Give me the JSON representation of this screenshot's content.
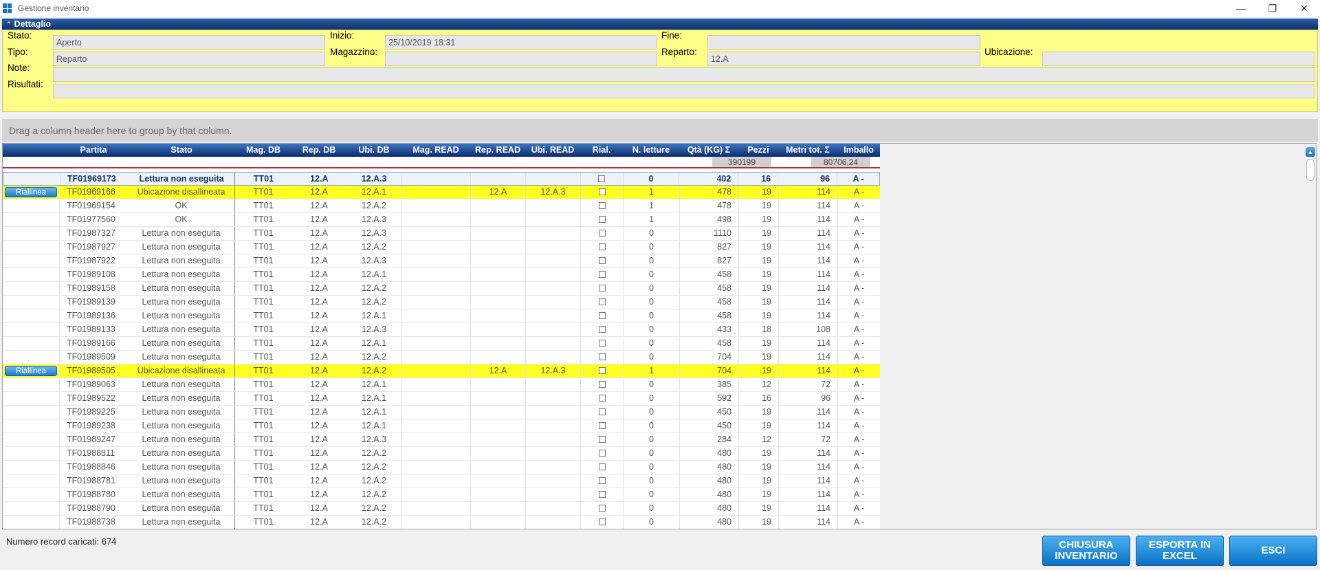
{
  "window": {
    "title": "Gestione inventario",
    "min_glyph": "—",
    "restore_glyph": "❐",
    "close_glyph": "✕"
  },
  "detail": {
    "header": "Dettaglio",
    "chevron": "⌃",
    "stato_label": "Stato:",
    "stato_value": "Aperto",
    "inizio_label": "Inizio:",
    "inizio_value": "25/10/2019 18:31",
    "fine_label": "Fine:",
    "fine_value": "",
    "tipo_label": "Tipo:",
    "tipo_value": "Reparto",
    "magazzino_label": "Magazzino:",
    "magazzino_value": "",
    "reparto_label": "Reparto:",
    "reparto_value": "12.A",
    "ubicazione_label": "Ubicazione:",
    "ubicazione_value": "",
    "note_label": "Note:",
    "note_value": "",
    "risultati_label": "Risultati:",
    "risultati_value": ""
  },
  "groupbar": {
    "text": "Drag a column header here to group by that column."
  },
  "grid": {
    "headers": {
      "btn": "",
      "partita": "Partita",
      "stato": "Stato",
      "mag_db": "Mag. DB",
      "rep_db": "Rep. DB",
      "ubi_db": "Ubi. DB",
      "mag_read": "Mag. READ",
      "rep_read": "Rep. READ",
      "ubi_read": "Ubi. READ",
      "rial": "Rial.",
      "n_letture": "N. letture",
      "qta": "Qtà (KG)  Σ",
      "pezzi": "Pezzi",
      "metri": "Metri tot.  Σ",
      "imballo": "Imballo"
    },
    "summary": {
      "qta": "390199",
      "metri": "80706,24"
    },
    "riallinea_label": "Riallinea",
    "rows": [
      {
        "btn": false,
        "partita": "TF01969173",
        "stato": "Lettura non eseguita",
        "mag": "TT01",
        "rep": "12.A",
        "ubi": "12.A.3",
        "magr": "",
        "repr": "",
        "ubir": "",
        "nlet": "0",
        "qta": "402",
        "pezzi": "16",
        "metri": "96",
        "imb": "A -",
        "kind": "first"
      },
      {
        "btn": true,
        "partita": "TF01969166",
        "stato": "Ubicazione disallineata",
        "mag": "TT01",
        "rep": "12.A",
        "ubi": "12.A.1",
        "magr": "",
        "repr": "12.A",
        "ubir": "12.A.3",
        "nlet": "1",
        "qta": "478",
        "pezzi": "19",
        "metri": "114",
        "imb": "A -",
        "kind": "yellow"
      },
      {
        "btn": false,
        "partita": "TF01969154",
        "stato": "OK",
        "mag": "TT01",
        "rep": "12.A",
        "ubi": "12.A.2",
        "magr": "",
        "repr": "",
        "ubir": "",
        "nlet": "1",
        "qta": "478",
        "pezzi": "19",
        "metri": "114",
        "imb": "A -",
        "kind": ""
      },
      {
        "btn": false,
        "partita": "TF01977560",
        "stato": "OK",
        "mag": "TT01",
        "rep": "12.A",
        "ubi": "12.A.3",
        "magr": "",
        "repr": "",
        "ubir": "",
        "nlet": "1",
        "qta": "498",
        "pezzi": "19",
        "metri": "114",
        "imb": "A -",
        "kind": ""
      },
      {
        "btn": false,
        "partita": "TF01987327",
        "stato": "Lettura non eseguita",
        "mag": "TT01",
        "rep": "12.A",
        "ubi": "12.A.3",
        "magr": "",
        "repr": "",
        "ubir": "",
        "nlet": "0",
        "qta": "1110",
        "pezzi": "19",
        "metri": "114",
        "imb": "A -",
        "kind": ""
      },
      {
        "btn": false,
        "partita": "TF01987927",
        "stato": "Lettura non eseguita",
        "mag": "TT01",
        "rep": "12.A",
        "ubi": "12.A.2",
        "magr": "",
        "repr": "",
        "ubir": "",
        "nlet": "0",
        "qta": "827",
        "pezzi": "19",
        "metri": "114",
        "imb": "A -",
        "kind": ""
      },
      {
        "btn": false,
        "partita": "TF01987922",
        "stato": "Lettura non eseguita",
        "mag": "TT01",
        "rep": "12.A",
        "ubi": "12.A.3",
        "magr": "",
        "repr": "",
        "ubir": "",
        "nlet": "0",
        "qta": "827",
        "pezzi": "19",
        "metri": "114",
        "imb": "A -",
        "kind": ""
      },
      {
        "btn": false,
        "partita": "TF01989108",
        "stato": "Lettura non eseguita",
        "mag": "TT01",
        "rep": "12.A",
        "ubi": "12.A.1",
        "magr": "",
        "repr": "",
        "ubir": "",
        "nlet": "0",
        "qta": "458",
        "pezzi": "19",
        "metri": "114",
        "imb": "A -",
        "kind": ""
      },
      {
        "btn": false,
        "partita": "TF01989158",
        "stato": "Lettura non eseguita",
        "mag": "TT01",
        "rep": "12.A",
        "ubi": "12.A.2",
        "magr": "",
        "repr": "",
        "ubir": "",
        "nlet": "0",
        "qta": "458",
        "pezzi": "19",
        "metri": "114",
        "imb": "A -",
        "kind": ""
      },
      {
        "btn": false,
        "partita": "TF01989139",
        "stato": "Lettura non eseguita",
        "mag": "TT01",
        "rep": "12.A",
        "ubi": "12.A.2",
        "magr": "",
        "repr": "",
        "ubir": "",
        "nlet": "0",
        "qta": "458",
        "pezzi": "19",
        "metri": "114",
        "imb": "A -",
        "kind": ""
      },
      {
        "btn": false,
        "partita": "TF01989136",
        "stato": "Lettura non eseguita",
        "mag": "TT01",
        "rep": "12.A",
        "ubi": "12.A.1",
        "magr": "",
        "repr": "",
        "ubir": "",
        "nlet": "0",
        "qta": "458",
        "pezzi": "19",
        "metri": "114",
        "imb": "A -",
        "kind": ""
      },
      {
        "btn": false,
        "partita": "TF01989133",
        "stato": "Lettura non eseguita",
        "mag": "TT01",
        "rep": "12.A",
        "ubi": "12.A.3",
        "magr": "",
        "repr": "",
        "ubir": "",
        "nlet": "0",
        "qta": "433",
        "pezzi": "18",
        "metri": "108",
        "imb": "A -",
        "kind": ""
      },
      {
        "btn": false,
        "partita": "TF01989166",
        "stato": "Lettura non eseguita",
        "mag": "TT01",
        "rep": "12.A",
        "ubi": "12.A.1",
        "magr": "",
        "repr": "",
        "ubir": "",
        "nlet": "0",
        "qta": "458",
        "pezzi": "19",
        "metri": "114",
        "imb": "A -",
        "kind": ""
      },
      {
        "btn": false,
        "partita": "TF01989509",
        "stato": "Lettura non eseguita",
        "mag": "TT01",
        "rep": "12.A",
        "ubi": "12.A.2",
        "magr": "",
        "repr": "",
        "ubir": "",
        "nlet": "0",
        "qta": "704",
        "pezzi": "19",
        "metri": "114",
        "imb": "A -",
        "kind": ""
      },
      {
        "btn": true,
        "partita": "TF01989505",
        "stato": "Ubicazione disallineata",
        "mag": "TT01",
        "rep": "12.A",
        "ubi": "12.A.2",
        "magr": "",
        "repr": "12.A",
        "ubir": "12.A.3",
        "nlet": "1",
        "qta": "704",
        "pezzi": "19",
        "metri": "114",
        "imb": "A -",
        "kind": "yellow"
      },
      {
        "btn": false,
        "partita": "TF01989063",
        "stato": "Lettura non eseguita",
        "mag": "TT01",
        "rep": "12.A",
        "ubi": "12.A.1",
        "magr": "",
        "repr": "",
        "ubir": "",
        "nlet": "0",
        "qta": "385",
        "pezzi": "12",
        "metri": "72",
        "imb": "A -",
        "kind": ""
      },
      {
        "btn": false,
        "partita": "TF01989522",
        "stato": "Lettura non eseguita",
        "mag": "TT01",
        "rep": "12.A",
        "ubi": "12.A.1",
        "magr": "",
        "repr": "",
        "ubir": "",
        "nlet": "0",
        "qta": "592",
        "pezzi": "16",
        "metri": "96",
        "imb": "A -",
        "kind": ""
      },
      {
        "btn": false,
        "partita": "TF01989225",
        "stato": "Lettura non eseguita",
        "mag": "TT01",
        "rep": "12.A",
        "ubi": "12.A.1",
        "magr": "",
        "repr": "",
        "ubir": "",
        "nlet": "0",
        "qta": "450",
        "pezzi": "19",
        "metri": "114",
        "imb": "A -",
        "kind": ""
      },
      {
        "btn": false,
        "partita": "TF01989238",
        "stato": "Lettura non eseguita",
        "mag": "TT01",
        "rep": "12.A",
        "ubi": "12.A.1",
        "magr": "",
        "repr": "",
        "ubir": "",
        "nlet": "0",
        "qta": "450",
        "pezzi": "19",
        "metri": "114",
        "imb": "A -",
        "kind": ""
      },
      {
        "btn": false,
        "partita": "TF01989247",
        "stato": "Lettura non eseguita",
        "mag": "TT01",
        "rep": "12.A",
        "ubi": "12.A.3",
        "magr": "",
        "repr": "",
        "ubir": "",
        "nlet": "0",
        "qta": "284",
        "pezzi": "12",
        "metri": "72",
        "imb": "A -",
        "kind": ""
      },
      {
        "btn": false,
        "partita": "TF01988811",
        "stato": "Lettura non eseguita",
        "mag": "TT01",
        "rep": "12.A",
        "ubi": "12.A.2",
        "magr": "",
        "repr": "",
        "ubir": "",
        "nlet": "0",
        "qta": "480",
        "pezzi": "19",
        "metri": "114",
        "imb": "A -",
        "kind": ""
      },
      {
        "btn": false,
        "partita": "TF01988846",
        "stato": "Lettura non eseguita",
        "mag": "TT01",
        "rep": "12.A",
        "ubi": "12.A.2",
        "magr": "",
        "repr": "",
        "ubir": "",
        "nlet": "0",
        "qta": "480",
        "pezzi": "19",
        "metri": "114",
        "imb": "A -",
        "kind": ""
      },
      {
        "btn": false,
        "partita": "TF01988781",
        "stato": "Lettura non eseguita",
        "mag": "TT01",
        "rep": "12.A",
        "ubi": "12.A.2",
        "magr": "",
        "repr": "",
        "ubir": "",
        "nlet": "0",
        "qta": "480",
        "pezzi": "19",
        "metri": "114",
        "imb": "A -",
        "kind": ""
      },
      {
        "btn": false,
        "partita": "TF01988780",
        "stato": "Lettura non eseguita",
        "mag": "TT01",
        "rep": "12.A",
        "ubi": "12.A.2",
        "magr": "",
        "repr": "",
        "ubir": "",
        "nlet": "0",
        "qta": "480",
        "pezzi": "19",
        "metri": "114",
        "imb": "A -",
        "kind": ""
      },
      {
        "btn": false,
        "partita": "TF01988790",
        "stato": "Lettura non eseguita",
        "mag": "TT01",
        "rep": "12.A",
        "ubi": "12.A.2",
        "magr": "",
        "repr": "",
        "ubir": "",
        "nlet": "0",
        "qta": "480",
        "pezzi": "19",
        "metri": "114",
        "imb": "A -",
        "kind": ""
      },
      {
        "btn": false,
        "partita": "TF01988738",
        "stato": "Lettura non eseguita",
        "mag": "TT01",
        "rep": "12.A",
        "ubi": "12.A.2",
        "magr": "",
        "repr": "",
        "ubir": "",
        "nlet": "0",
        "qta": "480",
        "pezzi": "19",
        "metri": "114",
        "imb": "A -",
        "kind": ""
      }
    ]
  },
  "footer": {
    "records": "Numero record caricati: 674",
    "chiusura": "CHIUSURA\nINVENTARIO",
    "esporta": "ESPORTA IN\nEXCEL",
    "esci": "ESCI"
  },
  "colors": {
    "accent": "#0a72c8",
    "panel": "#fdfd88",
    "highlight": "#ffff22"
  }
}
